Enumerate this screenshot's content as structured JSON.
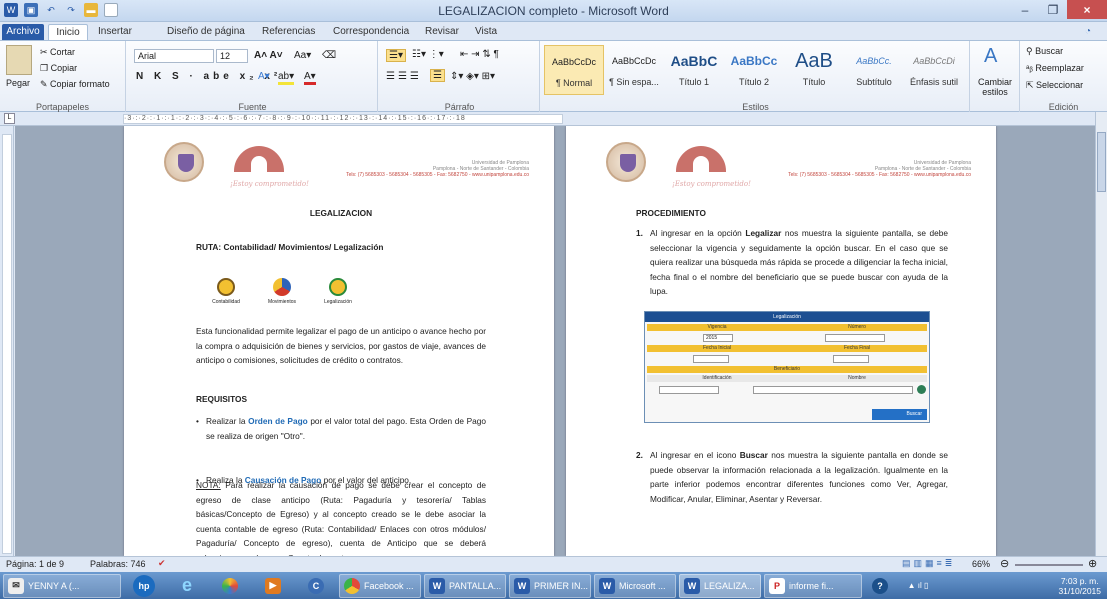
{
  "window": {
    "title": "LEGALIZACION completo - Microsoft Word"
  },
  "tabs": [
    "Archivo",
    "Inicio",
    "Insertar",
    "Diseño de página",
    "Referencias",
    "Correspondencia",
    "Revisar",
    "Vista"
  ],
  "ribbon": {
    "clipboard": {
      "cut": "Cortar",
      "copy": "Copiar",
      "paste": "Pegar",
      "format": "Copiar formato",
      "label": "Portapapeles"
    },
    "font": {
      "name": "Arial",
      "size": "12",
      "label": "Fuente"
    },
    "paragraph": {
      "label": "Párrafo"
    },
    "styles": {
      "label": "Estilos",
      "items": [
        {
          "preview": "AaBbCcDc",
          "name": "¶ Normal"
        },
        {
          "preview": "AaBbCcDc",
          "name": "¶ Sin espa..."
        },
        {
          "preview": "AaBbC",
          "name": "Título 1"
        },
        {
          "preview": "AaBbCc",
          "name": "Título 2"
        },
        {
          "preview": "AaB",
          "name": "Título"
        },
        {
          "preview": "AaBbCc.",
          "name": "Subtítulo"
        },
        {
          "preview": "AaBbCcDi",
          "name": "Énfasis sutil"
        }
      ],
      "change": "Cambiar estilos"
    },
    "edit": {
      "label": "Edición",
      "find": "Buscar",
      "replace": "Reemplazar",
      "select": "Seleccionar"
    }
  },
  "header": {
    "motto": "¡Estoy comprometido!",
    "university": "Universidad de Pamplona",
    "address": "Pamplona - Norte de Santander - Colombia",
    "phones": "Tels: (7) 5685303 - 5685304 - 5685305 - Fax: 5682750 - www.unipamplona.edu.co"
  },
  "page1": {
    "title": "LEGALIZACION",
    "route": "RUTA: Contabilidad/ Movimientos/ Legalización",
    "icons": [
      "Contabilidad",
      "Movimientos",
      "Legalización"
    ],
    "intro": "Esta funcionalidad permite legalizar el pago de un anticipo o avance hecho por la compra o adquisición de bienes y servicios, por gastos de viaje, avances de anticipo o comisiones, solicitudes de crédito o contratos.",
    "req_title": "REQUISITOS",
    "req1_a": "Realizar la ",
    "req1_link": "Orden de Pago",
    "req1_b": " por el valor total del pago. Esta Orden de Pago se realiza de origen \"Otro\".",
    "req2_a": "Realiza la ",
    "req2_link": "Causación de Pago",
    "req2_b": " por el valor del anticipo.",
    "note_label": "NOTA:",
    "note": " Para realizar la causación de pago se debe crear el concepto de egreso de clase anticipo (Ruta: Pagaduría y tesorería/ Tablas básicas/Concepto de Egreso) y al concepto creado se le debe asociar la cuenta contable de egreso (Ruta: Contabilidad/ Enlaces con otros módulos/ Pagaduría/ Concepto de egreso), cuenta de Anticipo que se deberá seleccionar en el campo Cuenta de costos."
  },
  "page2": {
    "title": "PROCEDIMIENTO",
    "step1_num": "1.",
    "step1_a": "Al ingresar en la opción ",
    "step1_b": "Legalizar",
    "step1_c": " nos muestra la siguiente pantalla, se debe seleccionar la vigencia y seguidamente la opción buscar. En el caso que se quiera realizar una búsqueda más rápida se procede a diligenciar la fecha inicial, fecha final o el nombre del beneficiario que se puede buscar con ayuda de la lupa.",
    "form": {
      "title": "Legalización",
      "vigencia": "Vigencia",
      "numero": "Número",
      "year": "2015",
      "fecha_ini": "Fecha Inicial",
      "fecha_fin": "Fecha Final",
      "beneficiario": "Beneficiario",
      "ident": "Identificación",
      "nombre": "Nombre",
      "buscar": "Buscar"
    },
    "step2_num": "2.",
    "step2_a": "Al ingresar en el icono ",
    "step2_b": "Buscar",
    "step2_c": " nos muestra la siguiente pantalla en donde se puede observar la información relacionada a la legalización. Igualmente en la parte inferior podemos encontrar diferentes funciones como Ver, Agregar, Modificar, Anular, Eliminar, Asentar y Reversar."
  },
  "status": {
    "page": "Página: 1 de 9",
    "words": "Palabras: 746",
    "zoom": "66%"
  },
  "taskbar": {
    "items": [
      "YENNY A (...",
      "Facebook ...",
      "PANTALLA...",
      "PRIMER IN...",
      "Microsoft ...",
      "LEGALIZA...",
      "informe fi..."
    ],
    "time": "7:03 p. m.",
    "date": "31/10/2015"
  }
}
